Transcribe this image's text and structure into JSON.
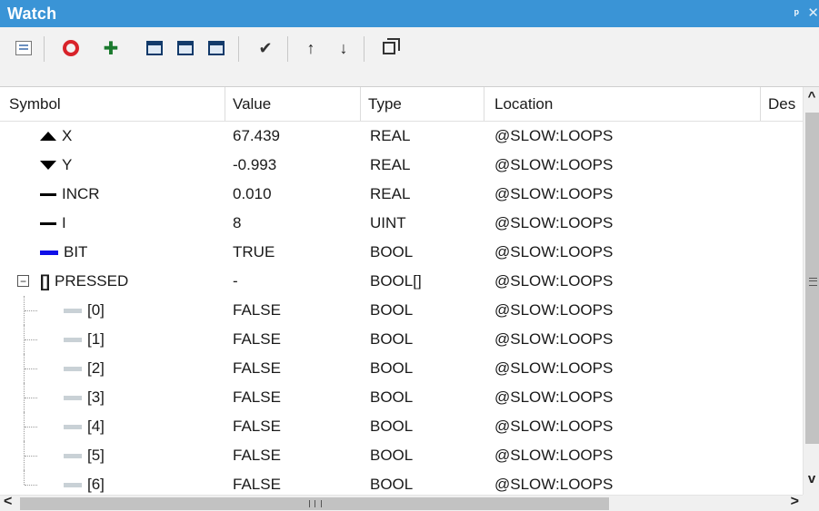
{
  "window": {
    "title": "Watch",
    "pin_glyph": "ᵖ",
    "close_glyph": "✕",
    "title_bg": "#3a94d6"
  },
  "toolbar": {
    "buttons": [
      {
        "name": "list-view-icon"
      },
      {
        "name": "remove-watch-icon",
        "color": "#d8232a"
      },
      {
        "name": "add-watch-icon"
      },
      {
        "name": "window-icon-1"
      },
      {
        "name": "window-icon-2"
      },
      {
        "name": "window-add-icon"
      },
      {
        "name": "write-value-icon"
      },
      {
        "name": "move-up-icon"
      },
      {
        "name": "move-down-icon"
      },
      {
        "name": "copy-icon"
      }
    ],
    "up_glyph": "↑",
    "down_glyph": "↓",
    "check_glyph": "✔",
    "add_glyph": "✚"
  },
  "columns": {
    "symbol": "Symbol",
    "value": "Value",
    "type": "Type",
    "location": "Location",
    "description": "Des"
  },
  "rows": [
    {
      "symbol": "X",
      "value": "67.439",
      "type": "REAL",
      "location": "@SLOW:LOOPS",
      "marker": "triangle-up"
    },
    {
      "symbol": "Y",
      "value": "-0.993",
      "type": "REAL",
      "location": "@SLOW:LOOPS",
      "marker": "triangle-down"
    },
    {
      "symbol": "INCR",
      "value": "0.010",
      "type": "REAL",
      "location": "@SLOW:LOOPS",
      "marker": "dash"
    },
    {
      "symbol": "I",
      "value": "8",
      "type": "UINT",
      "location": "@SLOW:LOOPS",
      "marker": "dash"
    },
    {
      "symbol": "BIT",
      "value": "TRUE",
      "type": "BOOL",
      "location": "@SLOW:LOOPS",
      "marker": "blue-bar"
    },
    {
      "symbol": "PRESSED",
      "value": "-",
      "type": "BOOL[]",
      "location": "@SLOW:LOOPS",
      "marker": "brackets",
      "expanded": true,
      "expander": "−"
    },
    {
      "symbol": "[0]",
      "value": "FALSE",
      "type": "BOOL",
      "location": "@SLOW:LOOPS",
      "marker": "gray-bar",
      "child": true
    },
    {
      "symbol": "[1]",
      "value": "FALSE",
      "type": "BOOL",
      "location": "@SLOW:LOOPS",
      "marker": "gray-bar",
      "child": true
    },
    {
      "symbol": "[2]",
      "value": "FALSE",
      "type": "BOOL",
      "location": "@SLOW:LOOPS",
      "marker": "gray-bar",
      "child": true
    },
    {
      "symbol": "[3]",
      "value": "FALSE",
      "type": "BOOL",
      "location": "@SLOW:LOOPS",
      "marker": "gray-bar",
      "child": true
    },
    {
      "symbol": "[4]",
      "value": "FALSE",
      "type": "BOOL",
      "location": "@SLOW:LOOPS",
      "marker": "gray-bar",
      "child": true
    },
    {
      "symbol": "[5]",
      "value": "FALSE",
      "type": "BOOL",
      "location": "@SLOW:LOOPS",
      "marker": "gray-bar",
      "child": true
    },
    {
      "symbol": "[6]",
      "value": "FALSE",
      "type": "BOOL",
      "location": "@SLOW:LOOPS",
      "marker": "gray-bar",
      "child": true
    }
  ],
  "brackets_glyph": "[]",
  "scrollbars": {
    "up": "^",
    "down": "v",
    "left": "<",
    "right": ">"
  }
}
